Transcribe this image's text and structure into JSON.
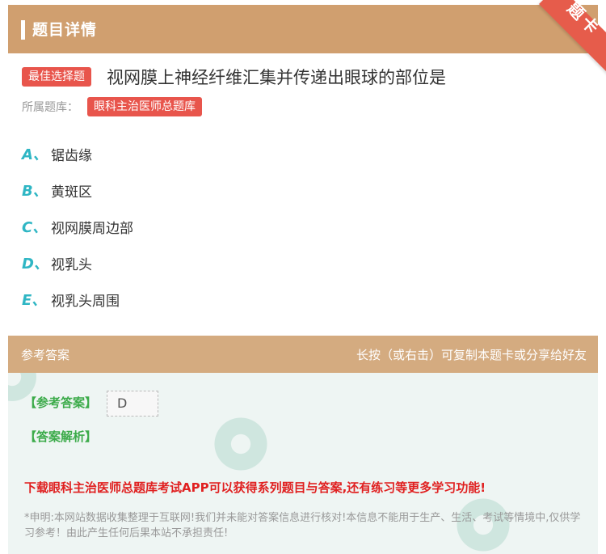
{
  "header": {
    "title": "题目详情"
  },
  "ribbon": {
    "text": "题卡"
  },
  "question": {
    "type_badge": "最佳选择题",
    "text": "视网膜上神经纤维汇集并传递出眼球的部位是",
    "bank_label": "所属题库：",
    "bank_name": "眼科主治医师总题库"
  },
  "options": [
    {
      "letter": "A、",
      "text": "锯齿缘"
    },
    {
      "letter": "B、",
      "text": "黄斑区"
    },
    {
      "letter": "C、",
      "text": "视网膜周边部"
    },
    {
      "letter": "D、",
      "text": "视乳头"
    },
    {
      "letter": "E、",
      "text": "视乳头周围"
    }
  ],
  "answer_section": {
    "title": "参考答案",
    "hint": "长按（或右击）可复制本题卡或分享给好友",
    "answer_label": "【参考答案】",
    "answer_value": "D",
    "explanation_label": "【答案解析】",
    "promo": "下载眼科主治医师总题库考试APP可以获得系列题目与答案,还有练习等更多学习功能!",
    "disclaimer": "*申明:本网站数据收集整理于互联网!我们并未能对答案信息进行核对!本信息不能用于生产、生活、考试等情境中,仅供学习参考！由此产生任何后果本站不承担责任!"
  },
  "colors": {
    "header_bg": "#d09f6f",
    "accent_red": "#e8554c",
    "option_letter": "#2fb6c4",
    "answer_green": "#3cab4a",
    "promo_red": "#e02020"
  }
}
